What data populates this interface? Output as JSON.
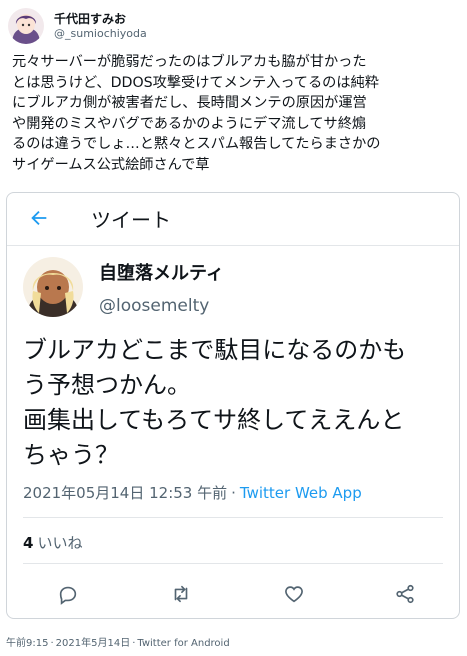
{
  "author": {
    "name": "千代田すみお",
    "handle": "@_sumiochiyoda"
  },
  "tweet": {
    "text": "元々サーバーが脆弱だったのはブルアカも脇が甘かった\nとは思うけど、DDOS攻撃受けてメンテ入ってるのは純粋\nにブルアカ側が被害者だし、長時間メンテの原因が運営\nや開発のミスやバグであるかのようにデマ流してサ終煽\nるのは違うでしょ…と黙々とスパム報告してたらまさかの\nサイゲームス公式絵師さんで草"
  },
  "embed": {
    "header_title": "ツイート",
    "quoted": {
      "name": "自堕落メルティ",
      "handle": "@loosemelty",
      "text": "ブルアカどこまで駄目になるのかも\nう予想つかん。\n画集出してもろてサ終してええんと\nちゃう？",
      "timestamp": "2021年05月14日 12:53 午前",
      "separator": "·",
      "source": "Twitter Web App",
      "likes_count": "4",
      "likes_label": "いいね"
    },
    "actions": [
      "reply-icon",
      "retweet-icon",
      "like-icon",
      "share-icon"
    ]
  },
  "footer": {
    "time": "午前9:15",
    "date": "2021年5月14日",
    "separator": "·",
    "client": "Twitter for Android"
  },
  "colors": {
    "accent": "#1d9bf0",
    "secondary_text": "#536471",
    "divider": "#e3e6e9"
  }
}
